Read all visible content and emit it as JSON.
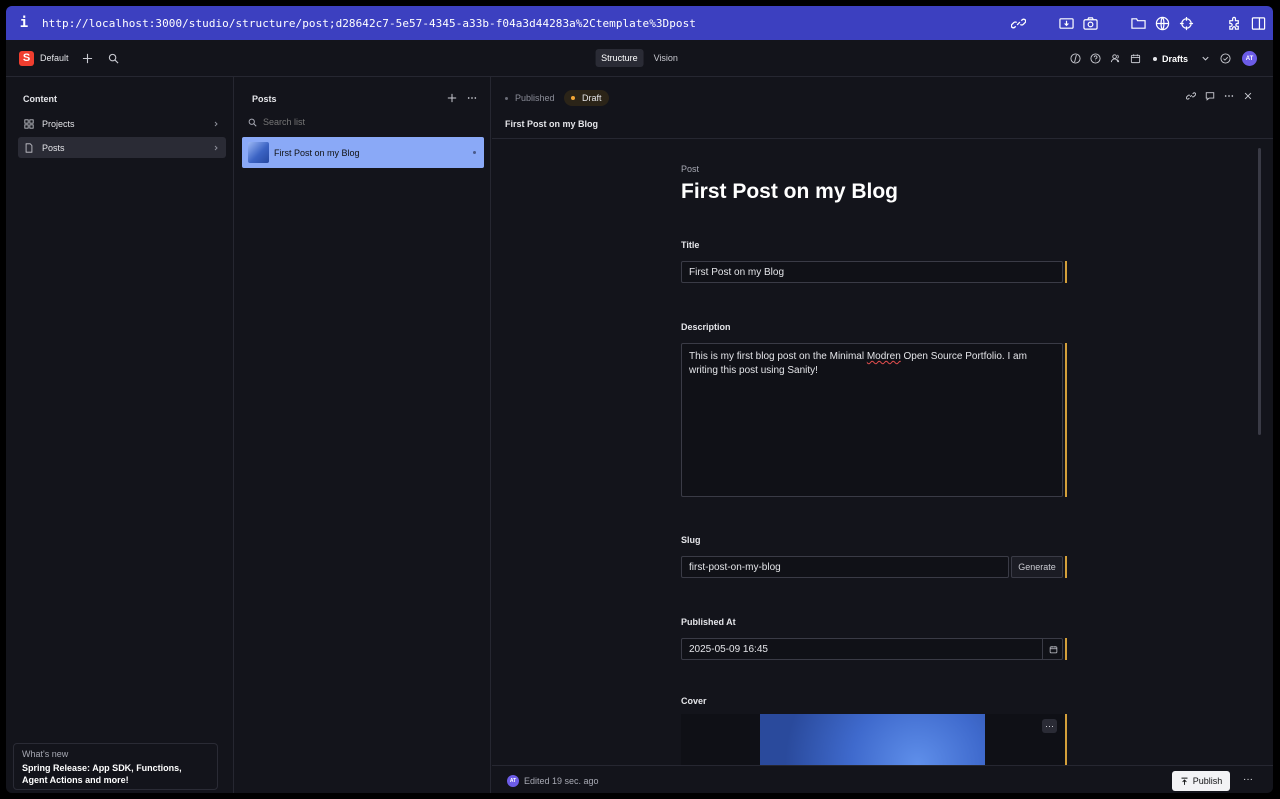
{
  "browser": {
    "info_glyph": "i",
    "url": "http://localhost:3000/studio/structure/post;d28642c7-5e57-4345-a33b-f04a3d44283a%2Ctemplate%3Dpost"
  },
  "topnav": {
    "logo_letter": "S",
    "workspace": "Default",
    "tabs": [
      "Structure",
      "Vision"
    ],
    "active_tab": "Structure",
    "drafts_label": "Drafts",
    "avatar_initials": "AT"
  },
  "content_pane": {
    "title": "Content",
    "items": [
      {
        "label": "Projects",
        "icon": "grid-icon"
      },
      {
        "label": "Posts",
        "icon": "document-icon"
      }
    ],
    "whats_new": {
      "label": "What's new",
      "text": "Spring Release: App SDK, Functions, Agent Actions and more!"
    }
  },
  "posts_pane": {
    "title": "Posts",
    "search_placeholder": "Search list",
    "items": [
      {
        "title": "First Post on my Blog"
      }
    ]
  },
  "doc_pane": {
    "status_published": "Published",
    "status_draft": "Draft",
    "breadcrumb": "First Post on my Blog",
    "doc_type": "Post",
    "doc_title": "First Post on my Blog",
    "fields": {
      "title": {
        "label": "Title",
        "value": "First Post on my Blog"
      },
      "description": {
        "label": "Description",
        "value_before": "This is my first blog post on the Minimal ",
        "value_misspelled": "Modren",
        "value_after": " Open Source Portfolio. I am writing this post using Sanity!"
      },
      "slug": {
        "label": "Slug",
        "value": "first-post-on-my-blog",
        "generate_label": "Generate"
      },
      "published_at": {
        "label": "Published At",
        "value": "2025-05-09 16:45"
      },
      "cover": {
        "label": "Cover",
        "menu_glyph": "···"
      }
    },
    "footer": {
      "avatar_initials": "AT",
      "edited": "Edited 19 sec. ago",
      "publish_label": "Publish",
      "more_glyph": "···"
    }
  },
  "colors": {
    "url_bar": "#3c40c0",
    "selected_post": "#8aa9f7",
    "draft_dot": "#f1a636",
    "brand_logo": "#f03e2f"
  }
}
